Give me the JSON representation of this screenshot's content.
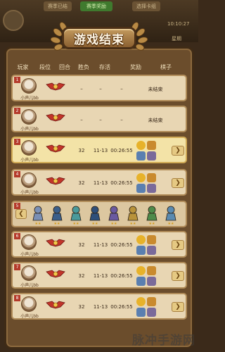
{
  "background": {
    "tab_left": "赛季已结",
    "tab_mid": "赛季奖励",
    "tab_right": "选择卡组",
    "time_text": "10:10:27",
    "corner_text": "星期"
  },
  "title": "游戏结束",
  "columns": {
    "player": "玩家",
    "rank": "段位",
    "round": "回合",
    "win_loss": "胜负",
    "survive": "存活",
    "reward": "奖励",
    "board": "棋子"
  },
  "rows": [
    {
      "num": "1",
      "name": "小声儿bb",
      "round": "–",
      "win_loss": "–",
      "survive": "–",
      "reward": "未结束",
      "has_icons": false
    },
    {
      "num": "2",
      "name": "小声儿bb",
      "round": "–",
      "win_loss": "–",
      "survive": "–",
      "reward": "未结束",
      "has_icons": false
    },
    {
      "num": "3",
      "name": "小声儿bb",
      "round": "32",
      "win_loss": "11-13",
      "survive": "00:26:55",
      "reward": "",
      "has_icons": true
    },
    {
      "num": "4",
      "name": "小声儿bb",
      "round": "32",
      "win_loss": "11-13",
      "survive": "00:26:55",
      "reward": "",
      "has_icons": true
    },
    {
      "num": "6",
      "name": "小声儿bb",
      "round": "32",
      "win_loss": "11-13",
      "survive": "00:26:55",
      "reward": "",
      "has_icons": true
    },
    {
      "num": "7",
      "name": "小声儿bb",
      "round": "32",
      "win_loss": "11-13",
      "survive": "00:26:55",
      "reward": "",
      "has_icons": true
    },
    {
      "num": "8",
      "name": "小声儿bb",
      "round": "32",
      "win_loss": "11-13",
      "survive": "00:26:55",
      "reward": "",
      "has_icons": true
    }
  ],
  "board_row": {
    "num": "5",
    "units": [
      "unit-1",
      "unit-2",
      "unit-3",
      "unit-4",
      "unit-5",
      "unit-6",
      "unit-7",
      "unit-8"
    ]
  },
  "watermark": "脉冲手游网",
  "colors": {
    "panel": "#6b4d2c",
    "row_bg": "#e8d6b3",
    "row_highlight": "#f3e3a7",
    "accent": "#c39a5e"
  }
}
